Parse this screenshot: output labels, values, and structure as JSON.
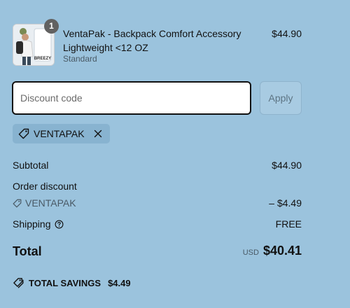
{
  "product": {
    "quantity": "1",
    "title": "VentaPak - Backpack Comfort Accessory Lightweight <12 OZ",
    "variant": "Standard",
    "price": "$44.90",
    "image": "product-photo-person-with-backpack",
    "image_text": "BREEZY"
  },
  "discount": {
    "placeholder": "Discount code",
    "value": "",
    "apply_label": "Apply",
    "applied_code": "VENTAPAK"
  },
  "summary": {
    "subtotal_label": "Subtotal",
    "subtotal_value": "$44.90",
    "order_discount_label": "Order discount",
    "discount_code": "VENTAPAK",
    "discount_value": "– $4.49",
    "shipping_label": "Shipping",
    "shipping_value": "FREE",
    "total_label": "Total",
    "currency": "USD",
    "total_value": "$40.41"
  },
  "savings": {
    "label": "TOTAL SAVINGS",
    "amount": "$4.49"
  },
  "icons": {
    "tag": "tag-icon",
    "close": "close-icon",
    "help": "help-circle-icon",
    "savings_tag": "double-tag-icon"
  },
  "colors": {
    "background": "#9bc3dd",
    "chip_background": "#88b3d0",
    "badge": "#616161",
    "text": "#111111",
    "muted_text": "#4a5a66"
  }
}
